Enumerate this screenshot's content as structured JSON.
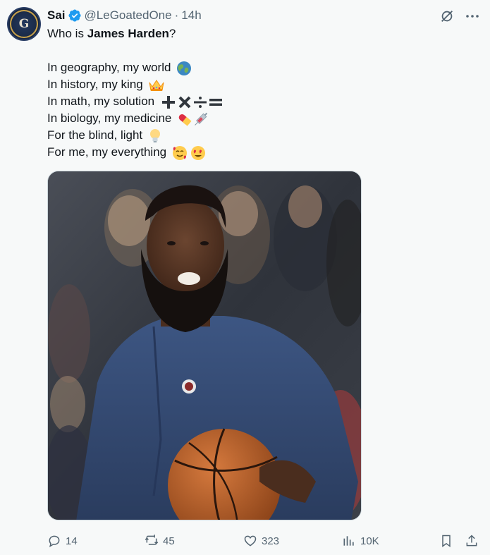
{
  "author": {
    "name": "Sai",
    "handle": "@LeGoatedOne",
    "separator": "·",
    "time": "14h",
    "avatar_letter": "G"
  },
  "tweet": {
    "lines": [
      {
        "pre": "Who is ",
        "bold": "James Harden",
        "post": "?"
      },
      {
        "text": "In geography, my world",
        "emoji": "globe-icon"
      },
      {
        "text": "In history, my king",
        "emoji": "crown-icon"
      },
      {
        "text": "In math, my solution",
        "emoji": "math-symbols-icon"
      },
      {
        "text": "In biology, my medicine",
        "emoji": "pill-syringe-icon"
      },
      {
        "text": "For the blind, light",
        "emoji": "lightbulb-icon"
      },
      {
        "text": "For me, my everything",
        "emoji": "love-faces-icon"
      }
    ]
  },
  "media": {
    "description_icon": "photo-basketball-player"
  },
  "actions": {
    "replies": "14",
    "reposts": "45",
    "likes": "323",
    "views": "10K"
  },
  "colors": {
    "background": "#f7f9f9",
    "text": "#0f1419",
    "muted": "#536471",
    "verified": "#1d9bf0"
  }
}
